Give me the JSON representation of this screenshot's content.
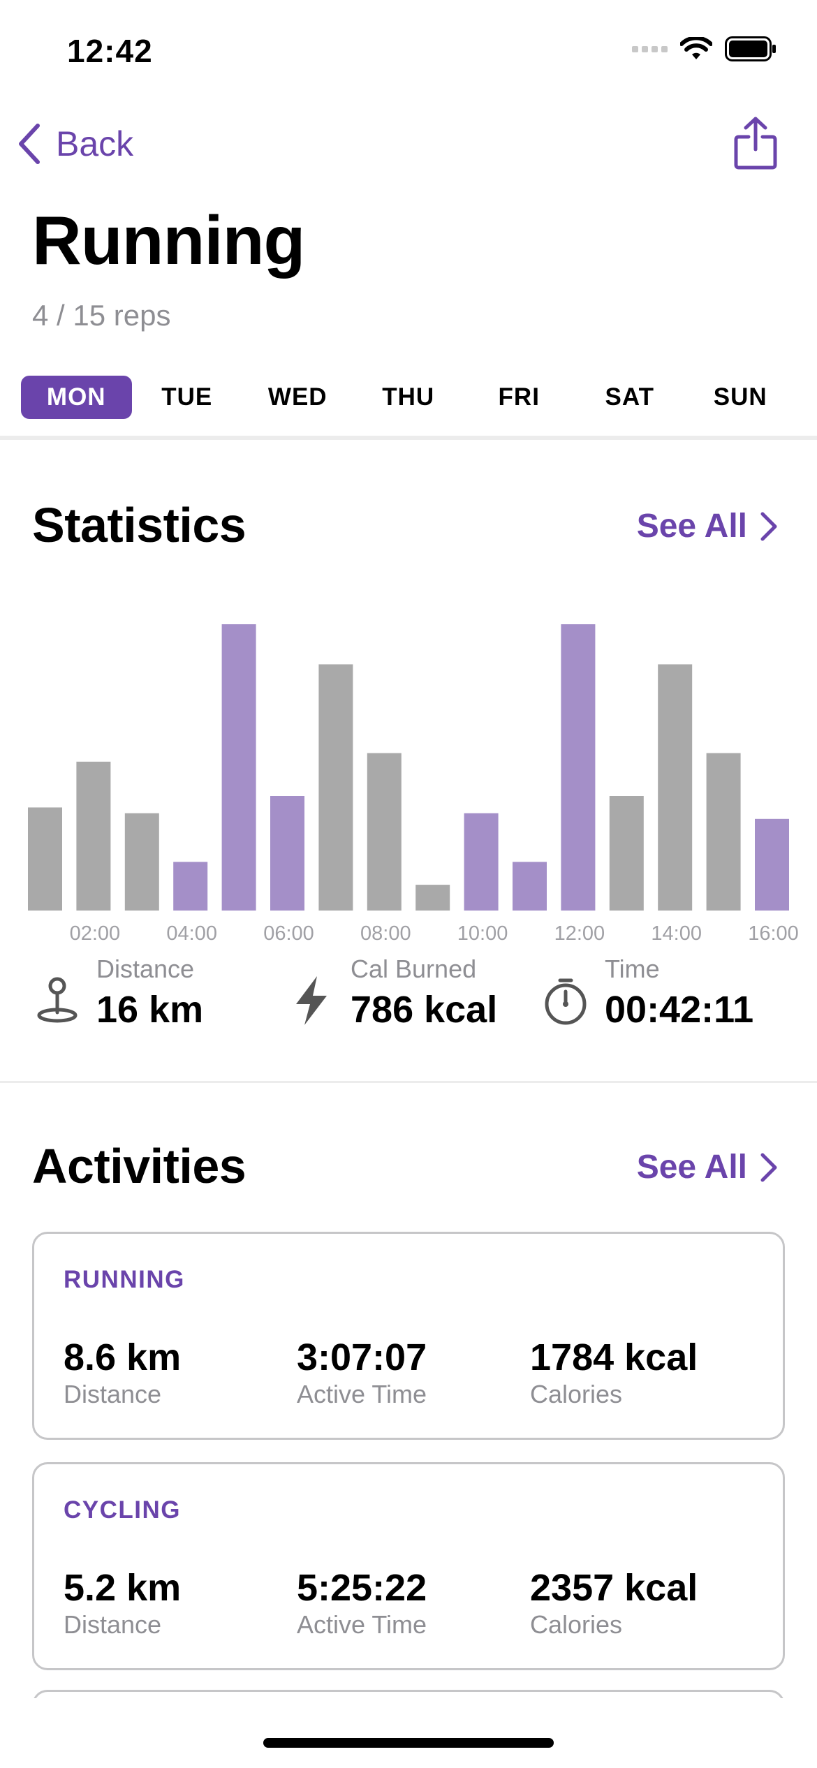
{
  "status_bar": {
    "time": "12:42",
    "icons": [
      "signal-icon",
      "wifi-icon",
      "battery-icon"
    ]
  },
  "nav": {
    "back_label": "Back",
    "share_icon": "share-icon"
  },
  "header": {
    "title": "Running",
    "subtitle": "4 / 15 reps"
  },
  "days": [
    {
      "label": "MON",
      "active": true
    },
    {
      "label": "TUE",
      "active": false
    },
    {
      "label": "WED",
      "active": false
    },
    {
      "label": "THU",
      "active": false
    },
    {
      "label": "FRI",
      "active": false
    },
    {
      "label": "SAT",
      "active": false
    },
    {
      "label": "SUN",
      "active": false
    }
  ],
  "statistics": {
    "title": "Statistics",
    "see_all": "See All",
    "stats": [
      {
        "icon": "location-pin-icon",
        "label": "Distance",
        "value": "16 km"
      },
      {
        "icon": "lightning-icon",
        "label": "Cal Burned",
        "value": "786 kcal"
      },
      {
        "icon": "stopwatch-icon",
        "label": "Time",
        "value": "00:42:11"
      }
    ]
  },
  "chart_data": {
    "type": "bar",
    "tick_labels": [
      "02:00",
      "04:00",
      "06:00",
      "08:00",
      "10:00",
      "12:00",
      "14:00",
      "16:00"
    ],
    "values": [
      36,
      52,
      34,
      17,
      100,
      40,
      86,
      55,
      9,
      34,
      17,
      100,
      40,
      86,
      55,
      32
    ],
    "highlighted": [
      false,
      false,
      false,
      true,
      true,
      true,
      false,
      false,
      false,
      true,
      true,
      true,
      false,
      false,
      false,
      true
    ],
    "ylim": [
      0,
      100
    ],
    "colors": {
      "default": "#a9a9a9",
      "highlight": "#a48fc8"
    }
  },
  "activities": {
    "title": "Activities",
    "see_all": "See All",
    "items": [
      {
        "name": "RUNNING",
        "distance": "8.6 km",
        "distance_label": "Distance",
        "active_time": "3:07:07",
        "active_time_label": "Active Time",
        "calories": "1784 kcal",
        "calories_label": "Calories"
      },
      {
        "name": "CYCLING",
        "distance": "5.2 km",
        "distance_label": "Distance",
        "active_time": "5:25:22",
        "active_time_label": "Active Time",
        "calories": "2357 kcal",
        "calories_label": "Calories"
      }
    ]
  },
  "colors": {
    "accent": "#6a44ab",
    "bar_gray": "#a9a9a9",
    "bar_purple": "#a48fc8",
    "secondary_text": "#8e8e93"
  }
}
